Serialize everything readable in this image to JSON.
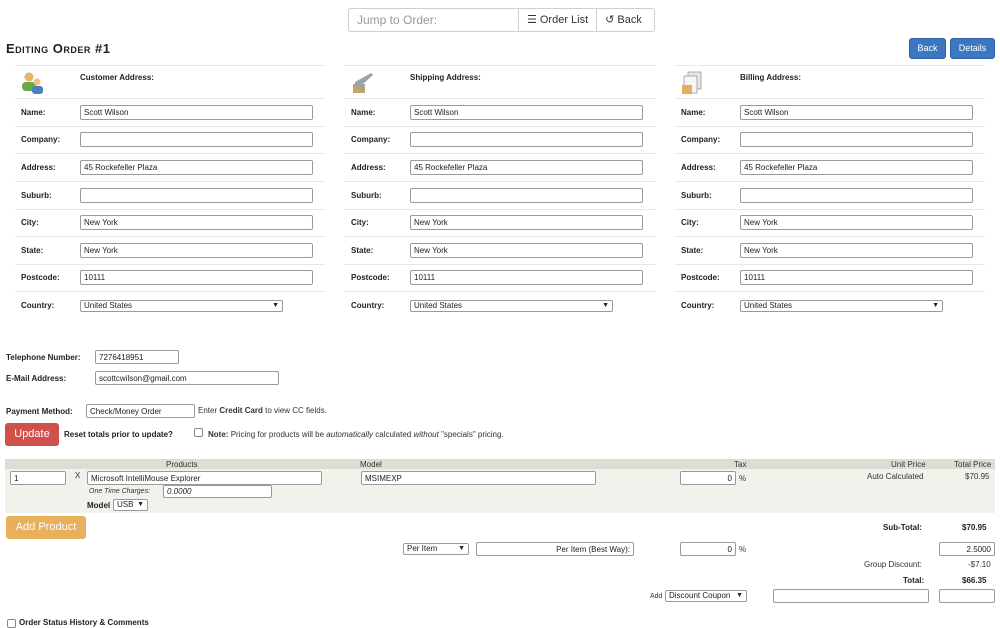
{
  "toolbar": {
    "jump_placeholder": "Jump to Order:",
    "order_list_label": "Order List",
    "back_label": "Back"
  },
  "page": {
    "title": "Editing Order #1",
    "back_button": "Back",
    "details_button": "Details"
  },
  "field_labels": {
    "name": "Name:",
    "company": "Company:",
    "address": "Address:",
    "suburb": "Suburb:",
    "city": "City:",
    "state": "State:",
    "postcode": "Postcode:",
    "country": "Country:"
  },
  "customer": {
    "heading": "Customer Address:",
    "icon": "customer-icon",
    "name": "Scott Wilson",
    "company": "",
    "address": "45 Rockefeller Plaza",
    "suburb": "",
    "city": "New York",
    "state": "New York",
    "postcode": "10111",
    "country": "United States"
  },
  "shipping": {
    "heading": "Shipping Address:",
    "icon": "airplane-icon",
    "name": "Scott Wilson",
    "company": "",
    "address": "45 Rockefeller Plaza",
    "suburb": "",
    "city": "New York",
    "state": "New York",
    "postcode": "10111",
    "country": "United States"
  },
  "billing": {
    "heading": "Billing Address:",
    "icon": "documents-icon",
    "name": "Scott Wilson",
    "company": "",
    "address": "45 Rockefeller Plaza",
    "suburb": "",
    "city": "New York",
    "state": "New York",
    "postcode": "10111",
    "country": "United States"
  },
  "contact": {
    "telephone_label": "Telephone Number:",
    "telephone": "7276418951",
    "email_label": "E-Mail Address:",
    "email": "scottcwilson@gmail.com"
  },
  "payment": {
    "label": "Payment Method:",
    "value": "Check/Money Order",
    "hint_prefix": "Enter",
    "hint_bold": "Credit Card",
    "hint_suffix": "to view CC fields."
  },
  "update": {
    "button": "Update",
    "reset_label": "Reset totals prior to update?",
    "note_label": "Note:",
    "note_1": "Pricing for products will be",
    "note_2": "automatically",
    "note_3": "calculated",
    "note_4": "without",
    "note_5": "\"specials\" pricing."
  },
  "products_table": {
    "headers": {
      "products": "Products",
      "model": "Model",
      "tax": "Tax",
      "unit_price": "Unit Price",
      "total_price": "Total Price"
    },
    "rows": [
      {
        "qty": "1",
        "x": "X",
        "name": "Microsoft IntelliMouse Explorer",
        "one_time_label": "One Time Charges:",
        "one_time_value": "0.0000",
        "attr_label": "Model",
        "attr_value": "USB",
        "model": "MSIMEXP",
        "tax": "0",
        "tax_unit": "%",
        "unit_price": "Auto Calculated",
        "total_price": "$70.95"
      }
    ]
  },
  "totals": {
    "add_product": "Add Product",
    "subtotal_label": "Sub-Total:",
    "subtotal": "$70.95",
    "per_item_select": "Per Item",
    "per_item_text": "Per Item (Best Way):",
    "shipping_tax": "0",
    "shipping_tax_unit": "%",
    "shipping_cost": "2.5000",
    "group_discount_label": "Group Discount:",
    "group_discount": "-$7.10",
    "total_label": "Total:",
    "total": "$66.35",
    "add_label": "Add",
    "add_select": "Discount Coupon"
  },
  "footer": {
    "status_history": "Order Status History & Comments"
  }
}
